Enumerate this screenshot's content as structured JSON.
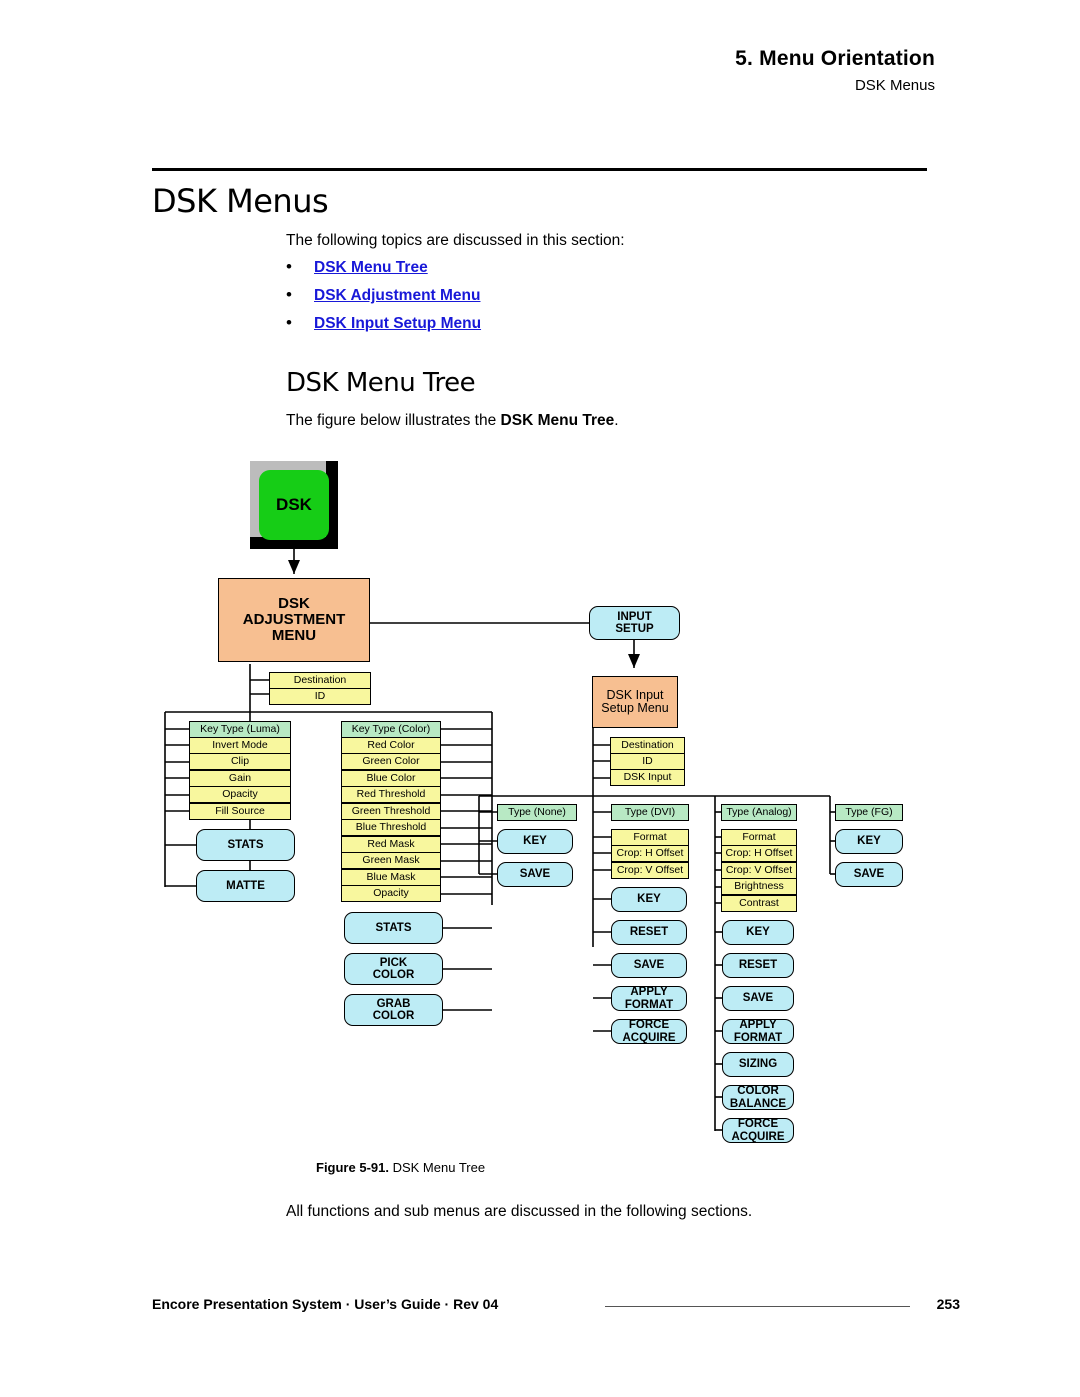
{
  "header": {
    "chapter_title": "5.  Menu Orientation",
    "subtitle": "DSK Menus"
  },
  "section": {
    "title": "DSK Menus",
    "intro": "The following topics are discussed in this section:",
    "bullet_glyph": "•",
    "topics": [
      {
        "label": "DSK Menu Tree"
      },
      {
        "label": "DSK Adjustment Menu"
      },
      {
        "label": "DSK Input Setup Menu"
      }
    ]
  },
  "subsection": {
    "title": "DSK Menu Tree",
    "intro_prefix": "The figure below illustrates the ",
    "intro_bold": "DSK Menu Tree",
    "intro_suffix": "."
  },
  "figure": {
    "caption_bold": "Figure 5-91.",
    "caption_text": "DSK Menu Tree",
    "closing_text": "All functions and sub menus are discussed in the following sections.",
    "hardware_key": "DSK",
    "root_menu": "DSK\nADJUSTMENT\nMENU",
    "root_menu_line1": "DSK",
    "root_menu_line2": "ADJUSTMENT",
    "root_menu_line3": "MENU",
    "input_setup_line1": "INPUT",
    "input_setup_line2": "SETUP",
    "dsk_input_menu_line1": "DSK Input",
    "dsk_input_menu_line2": "Setup Menu",
    "adjustment_params": [
      "Destination",
      "ID"
    ],
    "input_params": [
      "Destination",
      "ID",
      "DSK Input"
    ],
    "columns": {
      "key_type_luma": {
        "head": "Key Type (Luma)",
        "rows": [
          "Invert Mode",
          "Clip",
          "Gain",
          "Opacity",
          "Fill Source"
        ],
        "buttons": [
          "STATS",
          "MATTE"
        ]
      },
      "key_type_color": {
        "head": "Key Type (Color)",
        "rows": [
          "Red Color",
          "Green Color",
          "Blue Color",
          "Red Threshold",
          "Green Threshold",
          "Blue Threshold",
          "Red Mask",
          "Green Mask",
          "Blue Mask",
          "Opacity"
        ],
        "buttons": [
          "STATS",
          "PICK\nCOLOR",
          "GRAB\nCOLOR"
        ],
        "button_lines": [
          [
            "STATS"
          ],
          [
            "PICK",
            "COLOR"
          ],
          [
            "GRAB",
            "COLOR"
          ]
        ]
      },
      "type_none": {
        "head": "Type (None)",
        "rows": [],
        "button_lines": [
          [
            "KEY"
          ],
          [
            "SAVE"
          ]
        ]
      },
      "type_dvi": {
        "head": "Type (DVI)",
        "rows": [
          "Format",
          "Crop:  H Offset",
          "Crop:  V Offset"
        ],
        "button_lines": [
          [
            "KEY"
          ],
          [
            "RESET"
          ],
          [
            "SAVE"
          ],
          [
            "APPLY",
            "FORMAT"
          ],
          [
            "FORCE",
            "ACQUIRE"
          ]
        ]
      },
      "type_analog": {
        "head": "Type (Analog)",
        "rows": [
          "Format",
          "Crop:  H Offset",
          "Crop:  V Offset",
          "Brightness",
          "Contrast"
        ],
        "button_lines": [
          [
            "KEY"
          ],
          [
            "RESET"
          ],
          [
            "SAVE"
          ],
          [
            "APPLY",
            "FORMAT"
          ],
          [
            "SIZING"
          ],
          [
            "COLOR",
            "BALANCE"
          ],
          [
            "FORCE",
            "ACQUIRE"
          ]
        ]
      },
      "type_fg": {
        "head": "Type (FG)",
        "rows": [],
        "button_lines": [
          [
            "KEY"
          ],
          [
            "SAVE"
          ]
        ]
      }
    }
  },
  "footer": {
    "text": "Encore Presentation System  ·  User’s Guide  ·  Rev 04",
    "page_number": "253"
  },
  "colors": {
    "link": "#1818d8",
    "orange": "#f7bf91",
    "cyan": "#bdecf5",
    "green": "#b8e9c4",
    "yellow": "#f8f79e",
    "key_green": "#16cd16"
  }
}
